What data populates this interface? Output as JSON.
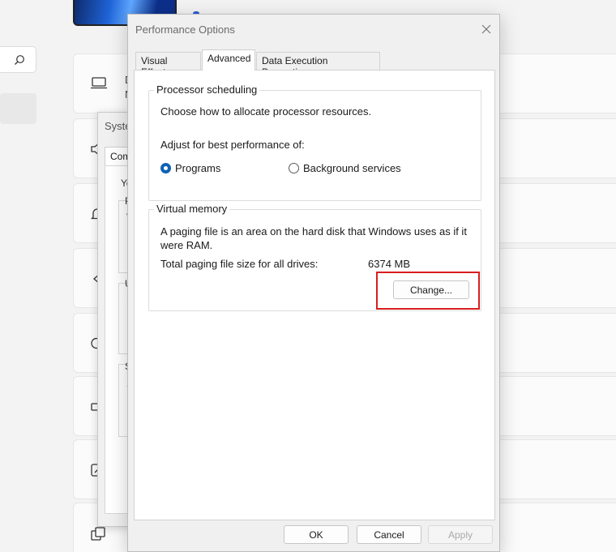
{
  "dialog": {
    "title": "Performance Options",
    "tabs": [
      {
        "label": "Visual Effects"
      },
      {
        "label": "Advanced"
      },
      {
        "label": "Data Execution Prevention"
      }
    ],
    "active_tab": "Advanced",
    "processor_scheduling": {
      "legend": "Processor scheduling",
      "description": "Choose how to allocate processor resources.",
      "adjust_label": "Adjust for best performance of:",
      "options": [
        {
          "label": "Programs",
          "selected": true
        },
        {
          "label": "Background services",
          "selected": false
        }
      ]
    },
    "virtual_memory": {
      "legend": "Virtual memory",
      "description": "A paging file is an area on the hard disk that Windows uses as if it were RAM.",
      "total_label": "Total paging file size for all drives:",
      "total_value": "6374 MB",
      "change_button": "Change..."
    },
    "buttons": {
      "ok": "OK",
      "cancel": "Cancel",
      "apply": "Apply"
    }
  },
  "background_window": {
    "title_fragment": "Syste",
    "tab_fragment": "Com",
    "text_fragments": [
      "Yo",
      "P",
      "V",
      "U",
      "D",
      "S",
      "S"
    ]
  },
  "settings_cards": {
    "text_fragments": [
      "D",
      "N"
    ]
  },
  "colors": {
    "accent": "#0f62b4",
    "highlight": "#d91e1e"
  }
}
